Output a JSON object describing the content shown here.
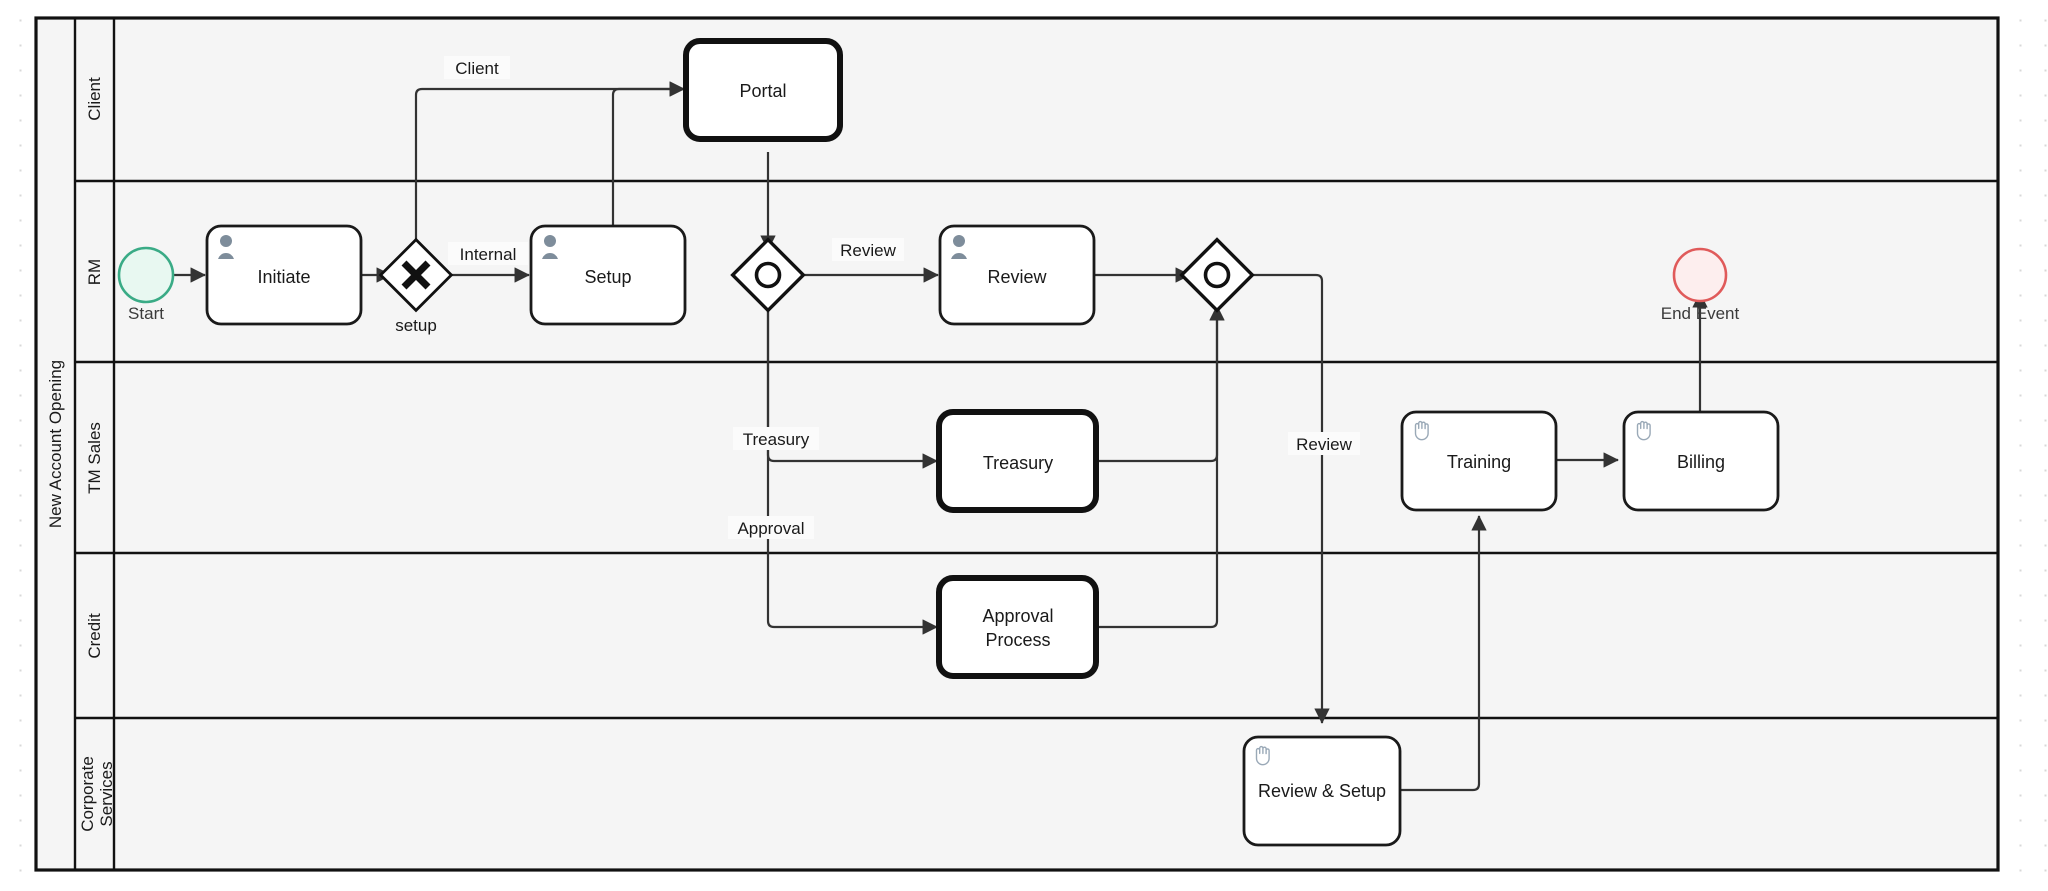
{
  "pool": {
    "name": "New Account Opening"
  },
  "lanes": [
    {
      "id": "client",
      "label": "Client"
    },
    {
      "id": "rm",
      "label": "RM"
    },
    {
      "id": "tm-sales",
      "label": "TM Sales"
    },
    {
      "id": "credit",
      "label": "Credit"
    },
    {
      "id": "corporate-services",
      "label": "Corporate",
      "label2": "Services"
    }
  ],
  "events": [
    {
      "id": "start",
      "type": "start-event",
      "label": "Start",
      "color": "#3aab86",
      "fill": "#e8f8f1"
    },
    {
      "id": "end",
      "type": "end-event",
      "label": "End Event",
      "color": "#e05a5a",
      "fill": "#fdeeee"
    }
  ],
  "tasks": [
    {
      "id": "initiate",
      "label": "Initiate",
      "icon": "user-task-icon",
      "lane": "rm",
      "emphasis": "normal"
    },
    {
      "id": "setup",
      "label": "Setup",
      "icon": "user-task-icon",
      "lane": "rm",
      "emphasis": "normal"
    },
    {
      "id": "portal",
      "label": "Portal",
      "icon": "none",
      "lane": "client",
      "emphasis": "thick"
    },
    {
      "id": "review",
      "label": "Review",
      "icon": "user-task-icon",
      "lane": "rm",
      "emphasis": "normal"
    },
    {
      "id": "treasury",
      "label": "Treasury",
      "icon": "none",
      "lane": "tm-sales",
      "emphasis": "thick"
    },
    {
      "id": "approval-process",
      "label": "Approval",
      "label2": "Process",
      "icon": "none",
      "lane": "credit",
      "emphasis": "thick"
    },
    {
      "id": "review-and-setup",
      "label": "Review & Setup",
      "icon": "manual-task-icon",
      "lane": "corporate-services",
      "emphasis": "normal"
    },
    {
      "id": "training",
      "label": "Training",
      "icon": "manual-task-icon",
      "lane": "tm-sales",
      "emphasis": "normal"
    },
    {
      "id": "billing",
      "label": "Billing",
      "icon": "manual-task-icon",
      "lane": "tm-sales",
      "emphasis": "normal"
    }
  ],
  "gateways": [
    {
      "id": "setup-gateway",
      "type": "exclusive-gateway",
      "label": "setup"
    },
    {
      "id": "split-gateway",
      "type": "inclusive-gateway",
      "label": ""
    },
    {
      "id": "join-gateway",
      "type": "inclusive-gateway",
      "label": ""
    }
  ],
  "flow_labels": {
    "client": "Client",
    "internal": "Internal",
    "review_top": "Review",
    "treasury": "Treasury",
    "approval": "Approval",
    "review_down": "Review"
  }
}
